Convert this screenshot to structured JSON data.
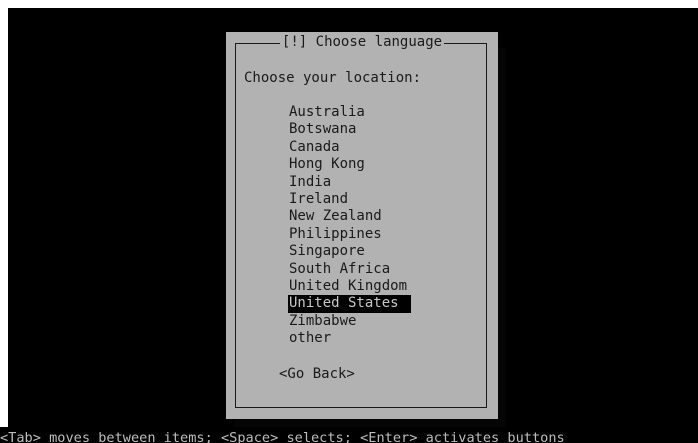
{
  "dialog": {
    "title": "[!] Choose language",
    "prompt": "Choose your location:",
    "countries": [
      "Australia",
      "Botswana",
      "Canada",
      "Hong Kong",
      "India",
      "Ireland",
      "New Zealand",
      "Philippines",
      "Singapore",
      "South Africa",
      "United Kingdom",
      "United States",
      "Zimbabwe",
      "other"
    ],
    "selected_country": "United States",
    "back_button": "<Go Back>"
  },
  "help_bar": {
    "text": "<Tab> moves between items; <Space> selects; <Enter> activates buttons"
  }
}
